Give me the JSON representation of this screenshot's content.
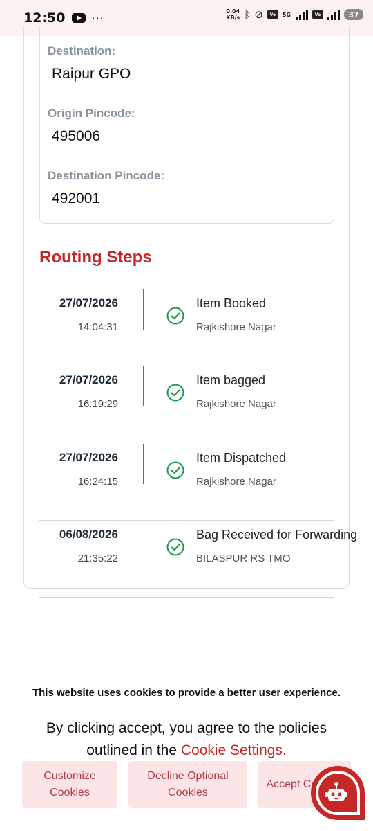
{
  "status_bar": {
    "time": "12:50",
    "speed_value": "0.04",
    "speed_unit": "KB/s",
    "net_label": "5G",
    "battery": "37",
    "icons": [
      "youtube-icon",
      "more-icon",
      "bluetooth-icon",
      "link-icon",
      "volte-icon",
      "signal-icon",
      "battery-icon"
    ]
  },
  "details": {
    "destination_label": "Destination:",
    "destination_value": "Raipur GPO",
    "origin_pincode_label": "Origin Pincode:",
    "origin_pincode_value": "495006",
    "destination_pincode_label": "Destination Pincode:",
    "destination_pincode_value": "492001"
  },
  "routing": {
    "title": "Routing Steps",
    "steps": [
      {
        "date": "27/07/2026",
        "time": "14:04:31",
        "event": "Item Booked",
        "location": "Rajkishore Nagar"
      },
      {
        "date": "27/07/2026",
        "time": "16:19:29",
        "event": "Item bagged",
        "location": "Rajkishore Nagar"
      },
      {
        "date": "27/07/2026",
        "time": "16:24:15",
        "event": "Item Dispatched",
        "location": "Rajkishore Nagar"
      },
      {
        "date": "06/08/2026",
        "time": "21:35:22",
        "event": "Bag Received for Forwarding",
        "location": "BILASPUR RS TMO"
      }
    ]
  },
  "cookie": {
    "heading": "This website uses cookies to provide a better user experience.",
    "text_before": "By clicking accept, you agree to the policies outlined in the ",
    "link": "Cookie Settings.",
    "customize_label": "Customize Cookies",
    "decline_label": "Decline Optional Cookies",
    "accept_label": "Accept Cookies"
  },
  "colors": {
    "accent": "#c62828",
    "timeline_green": "#1e9a4a",
    "button_bg": "#fde4e6"
  }
}
